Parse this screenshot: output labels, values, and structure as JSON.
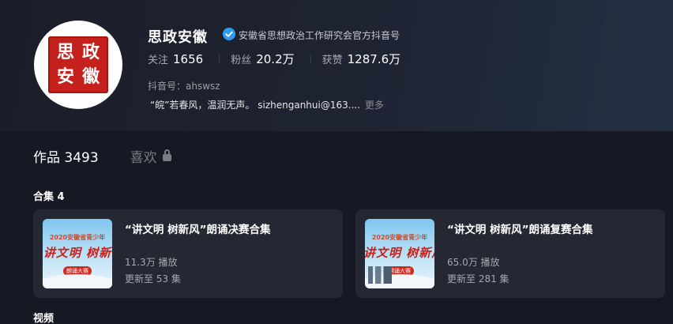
{
  "profile": {
    "avatar_text": [
      "思",
      "政",
      "安",
      "徽"
    ],
    "name": "思政安徽",
    "verified_label": "安徽省思想政治工作研究会官方抖音号",
    "stats": {
      "following_label": "关注",
      "following": "1656",
      "fans_label": "粉丝",
      "fans": "20.2万",
      "likes_label": "获赞",
      "likes": "1287.6万"
    },
    "douyin_id": "抖音号：ahswsz",
    "bio": "“皖”若春风，温润无声。 sizhenganhui@163....",
    "more_label": "更多"
  },
  "tabs": {
    "works_label": "作品 3493",
    "likes_label": "喜欢"
  },
  "collections": {
    "title": "合集 4",
    "items": [
      {
        "title": "“讲文明 树新风”朗诵决赛合集",
        "plays": "11.3万 播放",
        "updates": "更新至 53 集",
        "thumb_banner": "2020安徽省青少年",
        "thumb_text": "讲文明 树新",
        "thumb_pill": "朗诵大赛"
      },
      {
        "title": "“讲文明 树新风”朗诵复赛合集",
        "plays": "65.0万 播放",
        "updates": "更新至 281 集",
        "thumb_banner": "2020安徽省青少年",
        "thumb_text": "讲文明 树新风",
        "thumb_pill": "朗诵大赛"
      }
    ]
  },
  "videos": {
    "title": "视频"
  },
  "colors": {
    "background": "#161823",
    "verify_blue": "#2d9cf2",
    "seal_red": "#c4201c"
  }
}
